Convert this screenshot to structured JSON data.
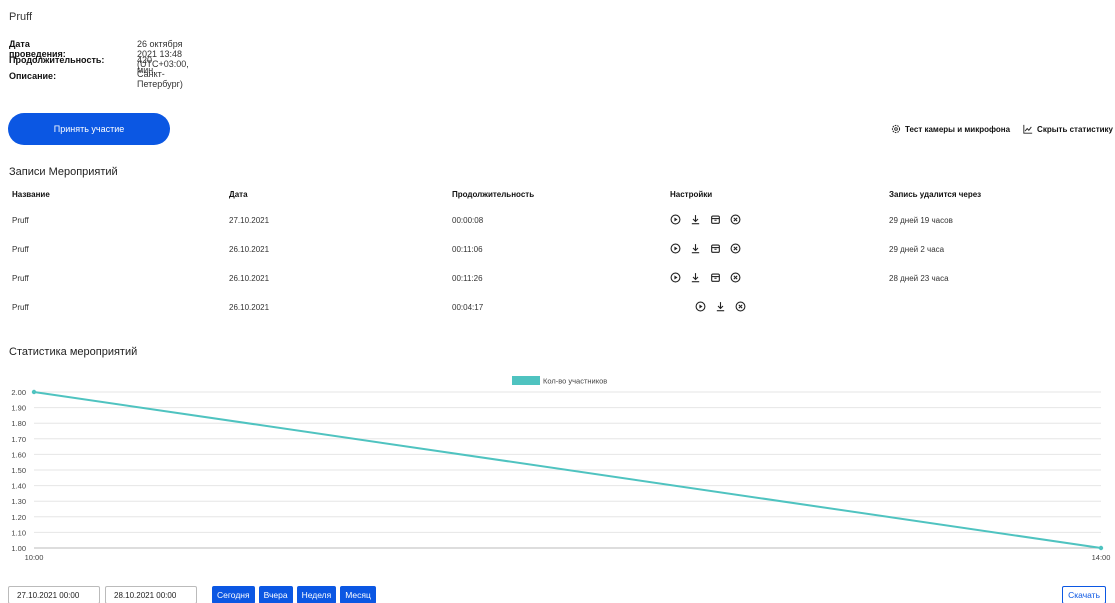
{
  "event": {
    "title": "Pruff",
    "meta": [
      {
        "label": "Дата проведения:",
        "value": "26 октября 2021 13:48 (UTC+03:00, Санкт-Петербург)"
      },
      {
        "label": "Продолжительность:",
        "value": "420 мин."
      },
      {
        "label": "Описание:",
        "value": ""
      }
    ],
    "join_label": "Принять участие"
  },
  "top_links": {
    "camera_test": "Тест камеры и микрофона",
    "hide_stats": "Скрыть статистику"
  },
  "records": {
    "title": "Записи Мероприятий",
    "columns": [
      "Название",
      "Дата",
      "Продолжительность",
      "Настройки",
      "Запись удалится через"
    ],
    "rows": [
      {
        "name": "Pruff",
        "date": "27.10.2021",
        "duration": "00:00:08",
        "icons": [
          "play-icon",
          "download-icon",
          "archive-icon",
          "delete-icon"
        ],
        "expires": "29 дней 19 часов"
      },
      {
        "name": "Pruff",
        "date": "26.10.2021",
        "duration": "00:11:06",
        "icons": [
          "play-icon",
          "download-icon",
          "archive-icon",
          "delete-icon"
        ],
        "expires": "29 дней 2 часа"
      },
      {
        "name": "Pruff",
        "date": "26.10.2021",
        "duration": "00:11:26",
        "icons": [
          "play-icon",
          "download-icon",
          "archive-icon",
          "delete-icon"
        ],
        "expires": "28 дней 23 часа"
      },
      {
        "name": "Pruff",
        "date": "26.10.2021",
        "duration": "00:04:17",
        "icons": [
          "play-icon",
          "download-icon",
          "delete-icon"
        ],
        "expires": ""
      }
    ]
  },
  "stats": {
    "title": "Статистика мероприятий",
    "date_from": "27.10.2021 00:00",
    "date_to": "28.10.2021 00:00",
    "ranges": [
      "Сегодня",
      "Вчера",
      "Неделя",
      "Месяц"
    ],
    "download_label": "Скачать"
  },
  "colors": {
    "accent": "#0b57e3",
    "series": "#4fc3c0"
  },
  "chart_data": {
    "type": "line",
    "title": "",
    "xlabel": "",
    "ylabel": "",
    "categories": [
      "10:00",
      "14:00"
    ],
    "series": [
      {
        "name": "Кол-во участников",
        "values": [
          2.0,
          1.0
        ]
      }
    ],
    "ylim": [
      1.0,
      2.0
    ],
    "yticks": [
      "2.00",
      "1.90",
      "1.80",
      "1.70",
      "1.60",
      "1.50",
      "1.40",
      "1.30",
      "1.20",
      "1.10",
      "1.00"
    ],
    "grid": true,
    "legend": "top-center"
  }
}
